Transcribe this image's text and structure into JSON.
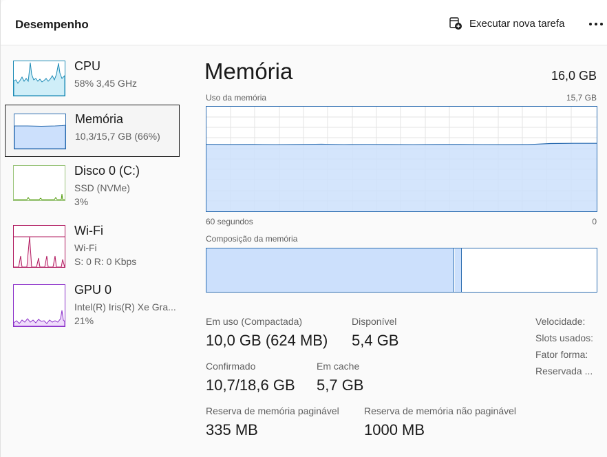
{
  "header": {
    "title": "Desempenho",
    "run_task_label": "Executar nova tarefa",
    "run_task_icon": "new-task-icon",
    "more_icon": "more-horizontal-icon"
  },
  "sidebar": {
    "items": [
      {
        "name": "CPU",
        "sub1": "58% 3,45 GHz",
        "sub2": "",
        "color": "#1b8ab5",
        "fill": "#cfeef8",
        "selected": false
      },
      {
        "name": "Memória",
        "sub1": "10,3/15,7 GB (66%)",
        "sub2": "",
        "color": "#2b6cb0",
        "fill": "#cce0fc",
        "selected": true
      },
      {
        "name": "Disco 0 (C:)",
        "sub1": "SSD (NVMe)",
        "sub2": "3%",
        "color": "#4e9a06",
        "fill": "#d9f2c7",
        "selected": false
      },
      {
        "name": "Wi-Fi",
        "sub1": "Wi-Fi",
        "sub2": "S: 0 R: 0 Kbps",
        "color": "#b0185e",
        "fill": "#fde4ef",
        "selected": false
      },
      {
        "name": "GPU 0",
        "sub1": "Intel(R) Iris(R) Xe Gra...",
        "sub2": "21%",
        "color": "#8b2fc9",
        "fill": "#efdcfb",
        "selected": false
      }
    ]
  },
  "main": {
    "title": "Memória",
    "total": "16,0 GB",
    "graph_label": "Uso da memória",
    "graph_max": "15,7 GB",
    "axis_left": "60 segundos",
    "axis_right": "0",
    "composition_label": "Composição da memória",
    "composition": {
      "in_use_fraction": 0.635,
      "modified_fraction": 0.018
    },
    "usage_fraction": 0.64,
    "stats": {
      "in_use_label": "Em uso (Compactada)",
      "in_use_value": "10,0 GB (624 MB)",
      "available_label": "Disponível",
      "available_value": "5,4 GB",
      "committed_label": "Confirmado",
      "committed_value": "10,7/18,6 GB",
      "cached_label": "Em cache",
      "cached_value": "5,7 GB",
      "paged_label": "Reserva de memória paginável",
      "paged_value": "335 MB",
      "nonpaged_label": "Reserva de memória não paginável",
      "nonpaged_value": "1000 MB"
    },
    "specs": {
      "speed": "Velocidade:",
      "slots": "Slots usados:",
      "form": "Fator forma:",
      "reserved": "Reservada ..."
    }
  },
  "colors": {
    "accent": "#2b6cb0",
    "memory_fill": "#cce0fc"
  }
}
